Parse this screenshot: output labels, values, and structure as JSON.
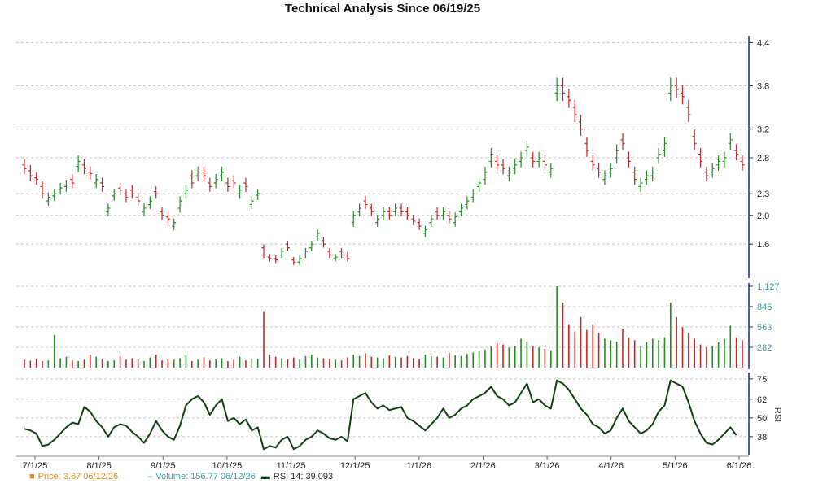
{
  "chart_data": {
    "type": "line",
    "title": "Technical Analysis Since 06/19/25",
    "colors": {
      "up": "#1f8f1f",
      "down": "#cc2222",
      "rsi": "#104010",
      "volume_axis": "#3b9c9c",
      "price_legend": "#e08a1e",
      "grid": "#c8c8c8",
      "axis": "#1a2a6c"
    },
    "x_ticks": [
      "7/1/25",
      "8/1/25",
      "9/1/25",
      "10/1/25",
      "11/1/25",
      "12/1/25",
      "1/1/26",
      "2/1/26",
      "3/1/26",
      "4/1/26",
      "5/1/26",
      "6/1/26"
    ],
    "price": {
      "y_ticks": [
        "4.4",
        "3.8",
        "3.2",
        "2.8",
        "2.3",
        "2.0",
        "1.6"
      ],
      "ylim": [
        1.15,
        4.45
      ],
      "closes": [
        2.65,
        2.55,
        2.5,
        2.3,
        2.25,
        2.3,
        2.38,
        2.42,
        2.45,
        2.75,
        2.65,
        2.58,
        2.5,
        2.4,
        2.1,
        2.3,
        2.35,
        2.25,
        2.3,
        2.2,
        2.1,
        2.2,
        2.3,
        2.0,
        1.95,
        1.9,
        2.2,
        2.35,
        2.45,
        2.6,
        2.55,
        2.4,
        2.5,
        2.6,
        2.4,
        2.45,
        2.35,
        2.4,
        2.2,
        2.3,
        1.45,
        1.4,
        1.38,
        1.5,
        1.55,
        1.35,
        1.4,
        1.5,
        1.6,
        1.75,
        1.6,
        1.45,
        1.42,
        1.45,
        1.4,
        2.0,
        2.1,
        2.15,
        2.05,
        1.95,
        2.05,
        2.0,
        2.1,
        2.05,
        2.0,
        1.92,
        1.85,
        1.8,
        1.95,
        2.0,
        2.05,
        1.95,
        1.98,
        2.1,
        2.2,
        2.3,
        2.45,
        2.6,
        2.85,
        2.7,
        2.65,
        2.6,
        2.7,
        2.8,
        2.95,
        2.75,
        2.8,
        2.7,
        2.65,
        3.8,
        3.7,
        3.6,
        3.4,
        3.2,
        2.9,
        2.7,
        2.6,
        2.55,
        2.65,
        2.9,
        3.0,
        2.75,
        2.5,
        2.45,
        2.55,
        2.6,
        2.85,
        3.0,
        3.8,
        3.75,
        3.65,
        3.4,
        3.0,
        2.75,
        2.55,
        2.65,
        2.75,
        2.8,
        3.05,
        2.85,
        2.7
      ],
      "opens": [
        2.7,
        2.62,
        2.52,
        2.4,
        2.2,
        2.27,
        2.36,
        2.4,
        2.5,
        2.68,
        2.7,
        2.6,
        2.45,
        2.45,
        2.05,
        2.27,
        2.38,
        2.3,
        2.35,
        2.25,
        2.05,
        2.15,
        2.33,
        2.05,
        1.98,
        1.85,
        2.1,
        2.3,
        2.55,
        2.55,
        2.6,
        2.45,
        2.45,
        2.55,
        2.45,
        2.48,
        2.3,
        2.45,
        2.15,
        2.28,
        1.55,
        1.42,
        1.4,
        1.45,
        1.6,
        1.38,
        1.35,
        1.45,
        1.55,
        1.7,
        1.65,
        1.5,
        1.4,
        1.5,
        1.45,
        1.9,
        2.05,
        2.2,
        2.1,
        1.9,
        2.0,
        2.05,
        2.05,
        2.1,
        2.05,
        1.95,
        1.9,
        1.75,
        1.9,
        2.05,
        2.0,
        2.0,
        1.9,
        2.05,
        2.15,
        2.25,
        2.4,
        2.5,
        2.75,
        2.75,
        2.7,
        2.55,
        2.65,
        2.75,
        2.9,
        2.8,
        2.75,
        2.75,
        2.6,
        3.7,
        3.8,
        3.65,
        3.5,
        3.3,
        3.0,
        2.75,
        2.65,
        2.5,
        2.6,
        2.8,
        3.05,
        2.8,
        2.6,
        2.4,
        2.5,
        2.55,
        2.8,
        2.9,
        3.7,
        3.8,
        3.7,
        3.5,
        3.1,
        2.85,
        2.6,
        2.6,
        2.7,
        2.75,
        3.0,
        2.9,
        2.75
      ]
    },
    "volume": {
      "y_ticks": [
        "1,127",
        "845",
        "563",
        "282"
      ],
      "ylim": [
        0,
        1127
      ],
      "values": [
        110,
        95,
        120,
        90,
        100,
        450,
        130,
        150,
        100,
        90,
        110,
        180,
        150,
        120,
        90,
        100,
        160,
        110,
        130,
        120,
        90,
        140,
        180,
        100,
        120,
        110,
        130,
        170,
        90,
        110,
        140,
        100,
        120,
        130,
        90,
        110,
        150,
        100,
        130,
        120,
        780,
        180,
        150,
        130,
        120,
        140,
        110,
        160,
        180,
        140,
        130,
        120,
        110,
        100,
        140,
        180,
        160,
        200,
        150,
        140,
        130,
        170,
        150,
        140,
        160,
        130,
        120,
        180,
        160,
        150,
        140,
        200,
        170,
        160,
        190,
        210,
        230,
        250,
        300,
        340,
        320,
        280,
        300,
        400,
        360,
        300,
        280,
        260,
        240,
        1127,
        900,
        600,
        500,
        700,
        520,
        600,
        480,
        400,
        380,
        360,
        540,
        420,
        380,
        300,
        350,
        400,
        380,
        420,
        900,
        700,
        560,
        480,
        400,
        320,
        280,
        300,
        350,
        400,
        580,
        420,
        380
      ]
    },
    "rsi": {
      "label": "RSI",
      "y_ticks": [
        "75",
        "62",
        "50",
        "38"
      ],
      "ylim": [
        27,
        77
      ],
      "values": [
        43,
        42,
        40,
        32,
        33,
        36,
        40,
        44,
        47,
        46,
        57,
        54,
        48,
        44,
        38,
        44,
        46,
        45,
        41,
        38,
        34,
        40,
        48,
        42,
        38,
        36,
        45,
        58,
        62,
        64,
        60,
        52,
        58,
        62,
        48,
        50,
        46,
        49,
        42,
        44,
        30,
        32,
        31,
        36,
        38,
        30,
        32,
        36,
        38,
        42,
        40,
        37,
        36,
        38,
        35,
        62,
        64,
        66,
        60,
        56,
        58,
        55,
        56,
        57,
        50,
        48,
        45,
        42,
        46,
        50,
        56,
        50,
        52,
        56,
        58,
        62,
        64,
        66,
        70,
        64,
        62,
        58,
        60,
        66,
        72,
        60,
        62,
        58,
        56,
        74,
        72,
        68,
        62,
        56,
        52,
        46,
        44,
        40,
        42,
        50,
        56,
        48,
        44,
        40,
        42,
        46,
        54,
        58,
        74,
        72,
        70,
        60,
        48,
        40,
        34,
        33,
        36,
        40,
        44,
        39
      ]
    },
    "legend": {
      "price": "Price: 3.67  06/12/26",
      "volume": "Volume: 156.77  06/12/26",
      "rsi": "RSI 14: 39.093"
    }
  }
}
